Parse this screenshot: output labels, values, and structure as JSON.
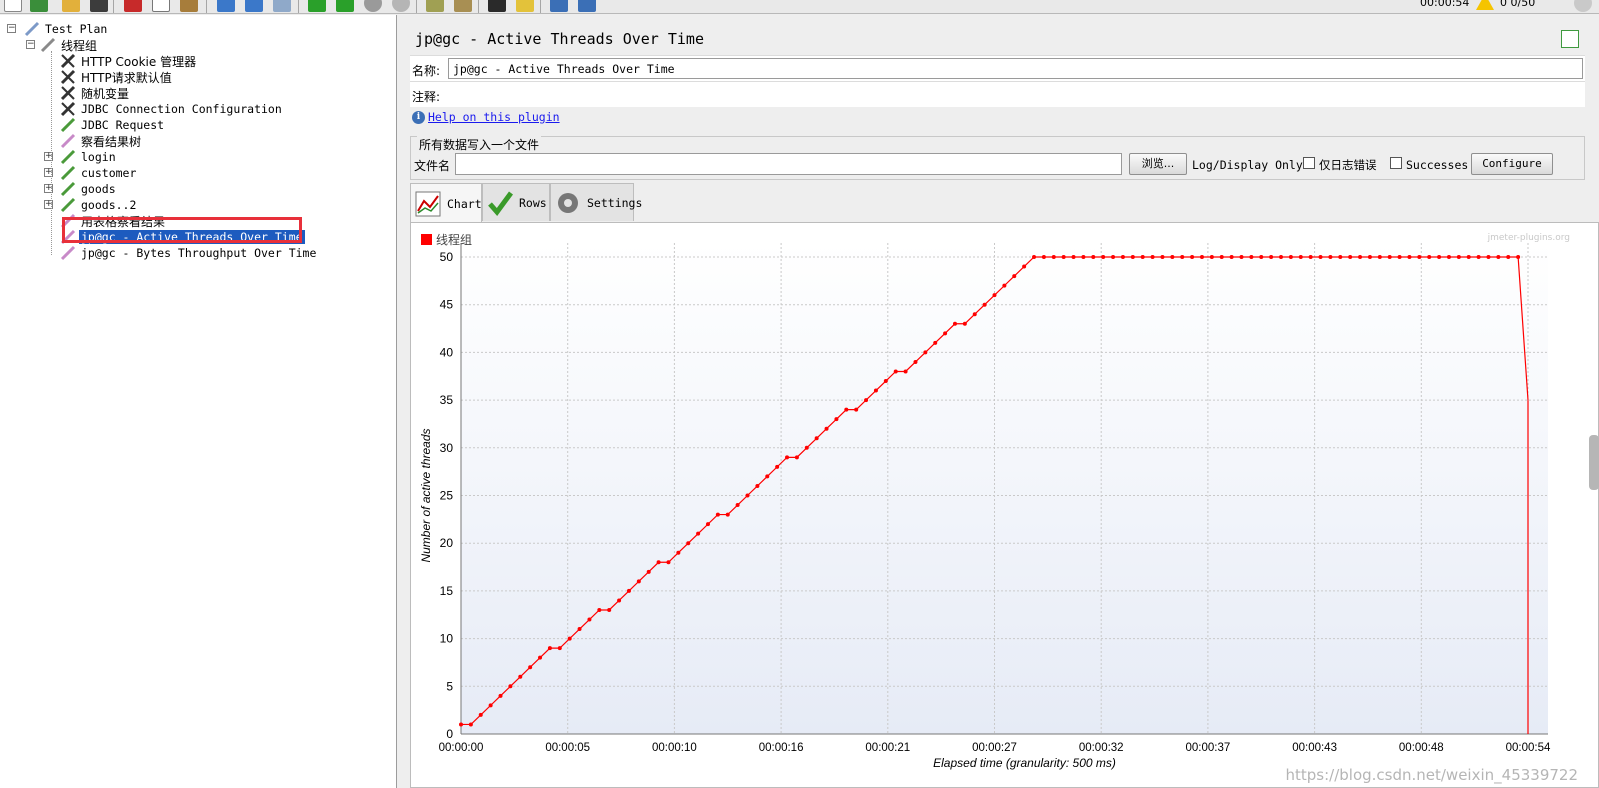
{
  "toolbar": {
    "timer": "00:00:54",
    "thread_count": "0 0/50",
    "icons": [
      "new-icon",
      "templates-icon",
      "open-icon",
      "save-icon",
      "cut-icon",
      "copy-icon",
      "paste-icon",
      "expand-icon",
      "collapse-icon",
      "toggle-icon",
      "start-icon",
      "start-no-pause-icon",
      "stop-icon",
      "shutdown-icon",
      "clear-icon",
      "clear-all-icon",
      "search-icon",
      "reset-search-icon",
      "function-helper-icon",
      "help-icon"
    ]
  },
  "tree": {
    "items": [
      {
        "label": "Test Plan",
        "icon": "test-plan-icon",
        "level": 0
      },
      {
        "label": "线程组",
        "icon": "thread-group-icon",
        "level": 1
      },
      {
        "label": "HTTP Cookie 管理器",
        "icon": "config-element-icon",
        "level": 2
      },
      {
        "label": "HTTP请求默认值",
        "icon": "config-element-icon",
        "level": 2
      },
      {
        "label": "随机变量",
        "icon": "config-element-icon",
        "level": 2
      },
      {
        "label": "JDBC Connection Configuration",
        "icon": "config-element-icon",
        "level": 2
      },
      {
        "label": "JDBC Request",
        "icon": "sampler-icon",
        "level": 2
      },
      {
        "label": "察看结果树",
        "icon": "listener-icon",
        "level": 2
      },
      {
        "label": "login",
        "icon": "sampler-icon",
        "level": 2
      },
      {
        "label": "customer",
        "icon": "sampler-icon",
        "level": 2
      },
      {
        "label": "goods",
        "icon": "sampler-icon",
        "level": 2
      },
      {
        "label": "goods..2",
        "icon": "sampler-icon",
        "level": 2
      },
      {
        "label": "用表格察看结果",
        "icon": "listener-icon",
        "level": 2
      },
      {
        "label": "jp@gc - Active Threads Over Time",
        "icon": "listener-icon",
        "level": 2,
        "selected": true
      },
      {
        "label": "jp@gc - Bytes Throughput Over Time",
        "icon": "listener-icon",
        "level": 2
      }
    ]
  },
  "panel": {
    "title": "jp@gc - Active Threads Over Time",
    "name_label": "名称:",
    "name_value": "jp@gc - Active Threads Over Time",
    "comment_label": "注释:",
    "comment_value": "",
    "help_link": "Help on this plugin",
    "file_group_title": "所有数据写入一个文件",
    "filename_label": "文件名",
    "browse_button": "浏览...",
    "log_display_label": "Log/Display Only:",
    "errors_only_label": "仅日志错误",
    "successes_label": "Successes",
    "configure_button": "Configure",
    "tabs": [
      {
        "label": "Chart",
        "icon": "chart-icon",
        "active": true
      },
      {
        "label": "Rows",
        "icon": "rows-checkmark-icon",
        "active": false
      },
      {
        "label": "Settings",
        "icon": "settings-gear-icon",
        "active": false
      }
    ],
    "plugin_watermark": "jmeter-plugins.org",
    "csdn_watermark": "https://blog.csdn.net/weixin_45339722"
  },
  "colors": {
    "series": "#ff0000",
    "annotation": "#e8303a",
    "selection": "#1d5bbf"
  },
  "chart_data": {
    "type": "line",
    "title": "",
    "xlabel": "Elapsed time (granularity: 500 ms)",
    "ylabel": "Number of active threads",
    "ylim": [
      0,
      50
    ],
    "yticks": [
      0,
      5,
      10,
      15,
      20,
      25,
      30,
      35,
      40,
      45,
      50
    ],
    "xtick_labels": [
      "00:00:00",
      "00:00:05",
      "00:00:10",
      "00:00:16",
      "00:00:21",
      "00:00:27",
      "00:00:32",
      "00:00:37",
      "00:00:43",
      "00:00:48",
      "00:00:54"
    ],
    "xlim_seconds": [
      0,
      54
    ],
    "grid": true,
    "legend_position": "top-left",
    "series": [
      {
        "name": "线程组",
        "x": [
          0,
          0.5,
          1,
          1.5,
          2,
          2.5,
          3,
          3.5,
          4,
          4.5,
          5,
          5.5,
          6,
          6.5,
          7,
          7.5,
          8,
          8.5,
          9,
          9.5,
          10,
          10.5,
          11,
          11.5,
          12,
          12.5,
          13,
          13.5,
          14,
          14.5,
          15,
          15.5,
          16,
          16.5,
          17,
          17.5,
          18,
          18.5,
          19,
          19.5,
          20,
          20.5,
          21,
          21.5,
          22,
          22.5,
          23,
          23.5,
          24,
          24.5,
          25,
          25.5,
          26,
          26.5,
          27,
          27.5,
          28,
          28.5,
          29,
          29.5,
          30,
          30.5,
          31,
          31.5,
          32,
          32.5,
          33,
          33.5,
          34,
          34.5,
          35,
          35.5,
          36,
          36.5,
          37,
          37.5,
          38,
          38.5,
          39,
          39.5,
          40,
          40.5,
          41,
          41.5,
          42,
          42.5,
          43,
          43.5,
          44,
          44.5,
          45,
          45.5,
          46,
          46.5,
          47,
          47.5,
          48,
          48.5,
          49,
          49.5,
          50,
          50.5,
          51,
          51.5,
          52,
          52.5,
          53,
          53.5,
          54
        ],
        "y": [
          1,
          1,
          2,
          3,
          4,
          5,
          6,
          7,
          8,
          9,
          9,
          10,
          11,
          12,
          13,
          13,
          14,
          15,
          16,
          17,
          18,
          18,
          19,
          20,
          21,
          22,
          23,
          23,
          24,
          25,
          26,
          27,
          28,
          29,
          29,
          30,
          31,
          32,
          33,
          34,
          34,
          35,
          36,
          37,
          38,
          38,
          39,
          40,
          41,
          42,
          43,
          43,
          44,
          45,
          46,
          47,
          48,
          49,
          50,
          50,
          50,
          50,
          50,
          50,
          50,
          50,
          50,
          50,
          50,
          50,
          50,
          50,
          50,
          50,
          50,
          50,
          50,
          50,
          50,
          50,
          50,
          50,
          50,
          50,
          50,
          50,
          50,
          50,
          50,
          50,
          50,
          50,
          50,
          50,
          50,
          50,
          50,
          50,
          50,
          50,
          50,
          50,
          50,
          50,
          50,
          50,
          50,
          50,
          35
        ]
      }
    ]
  }
}
